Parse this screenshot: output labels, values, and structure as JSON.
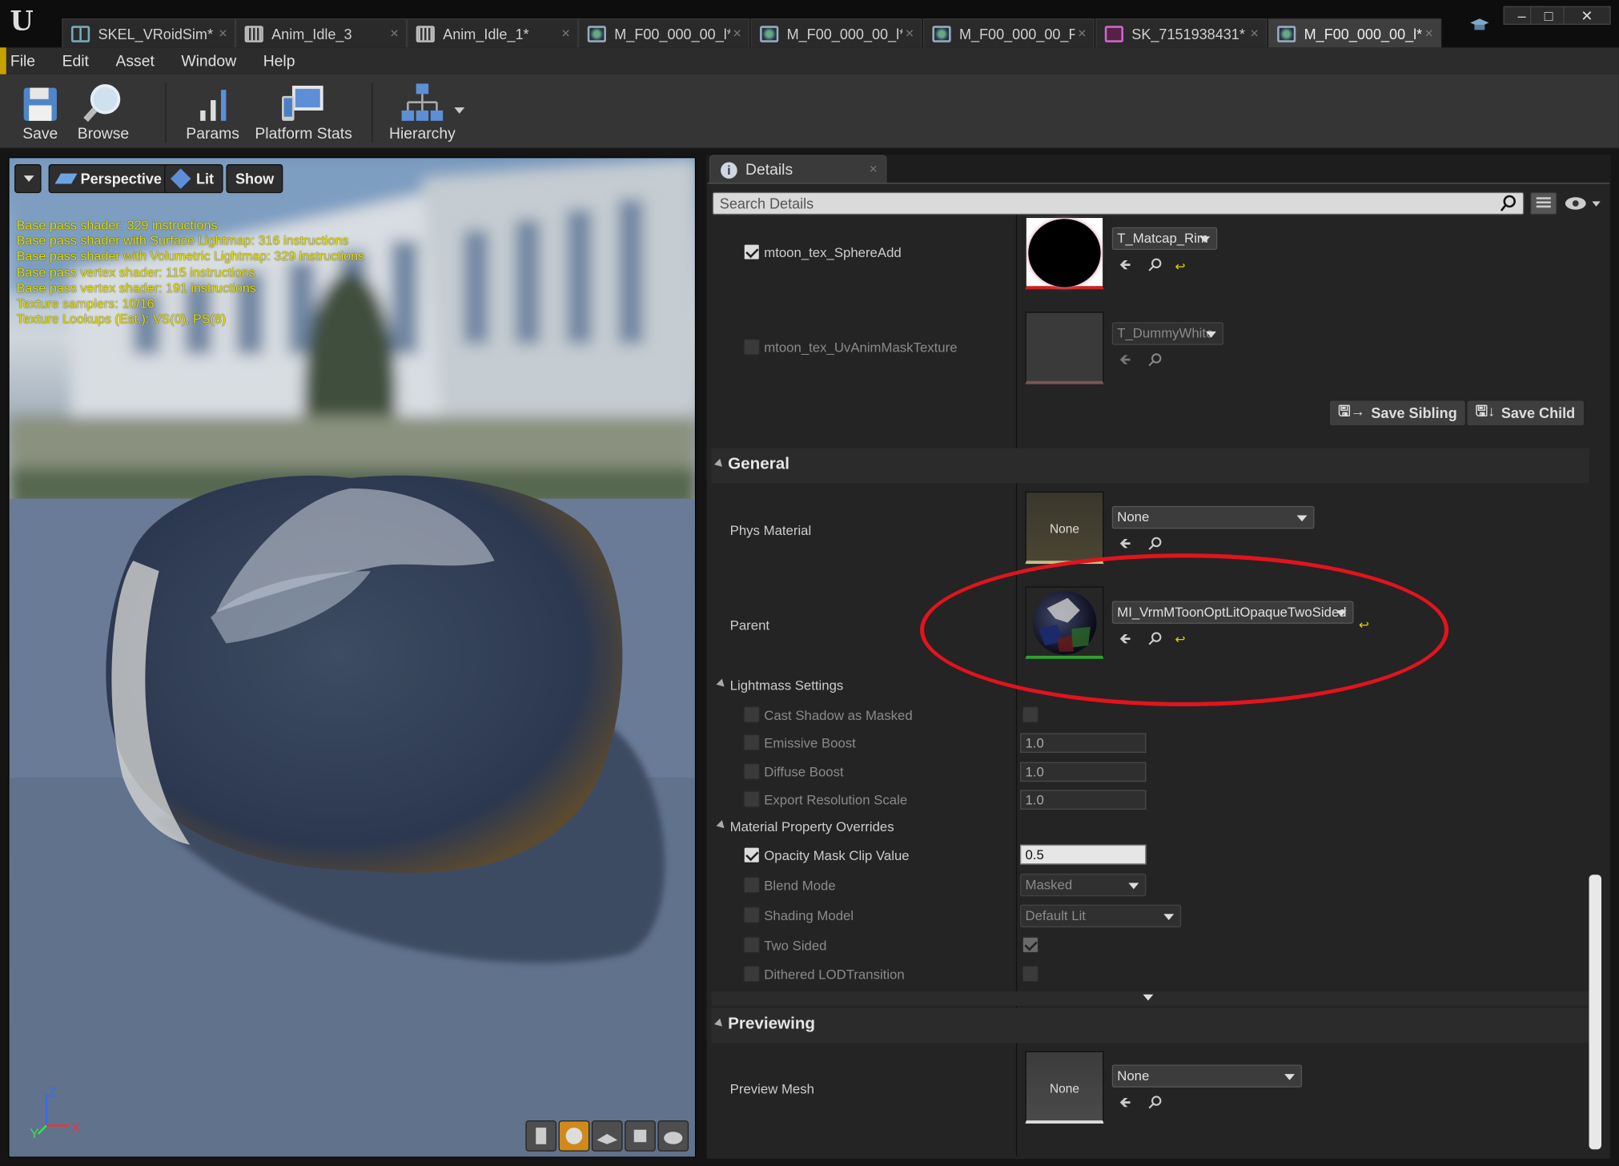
{
  "window": {
    "tabs": [
      {
        "label": "SKEL_VRoidSim*",
        "icon": "skeleton-icon"
      },
      {
        "label": "Anim_Idle_3",
        "icon": "animation-icon"
      },
      {
        "label": "Anim_Idle_1*",
        "icon": "animation-icon"
      },
      {
        "label": "M_F00_000_00_l*",
        "icon": "material-instance-icon"
      },
      {
        "label": "M_F00_000_00_l*",
        "icon": "material-instance-icon"
      },
      {
        "label": "M_F00_000_00_F",
        "icon": "material-instance-icon"
      },
      {
        "label": "SK_7151938431*",
        "icon": "skeletal-mesh-icon"
      },
      {
        "label": "M_F00_000_00_l*",
        "icon": "material-instance-icon"
      }
    ],
    "controls": {
      "minimize": "–",
      "maximize": "□",
      "close": "✕"
    }
  },
  "menu": [
    "File",
    "Edit",
    "Asset",
    "Window",
    "Help"
  ],
  "toolbar": {
    "save": "Save",
    "browse": "Browse",
    "params": "Params",
    "platform_stats": "Platform Stats",
    "hierarchy": "Hierarchy"
  },
  "viewport": {
    "buttons": {
      "perspective": "Perspective",
      "lit": "Lit",
      "show": "Show"
    },
    "stats": [
      "Base pass shader: 329 instructions",
      "Base pass shader with Surface Lightmap: 316 instructions",
      "Base pass shader with Volumetric Lightmap: 329 instructions",
      "Base pass vertex shader: 115 instructions",
      "Base pass vertex shader: 191 instructions",
      "Texture samplers: 10/16",
      "Texture Lookups (Est.): VS(0), PS(8)"
    ],
    "axes": {
      "z": "Z",
      "x": "X",
      "y": "Y"
    }
  },
  "details": {
    "tab_label": "Details",
    "search_placeholder": "Search Details",
    "textures": {
      "sphere_add": {
        "label": "mtoon_tex_SphereAdd",
        "value": "T_Matcap_Rim"
      },
      "uv_anim_mask": {
        "label": "mtoon_tex_UvAnimMaskTexture",
        "value": "T_DummyWhite"
      }
    },
    "save_sibling": "Save Sibling",
    "save_child": "Save Child",
    "general": {
      "title": "General",
      "phys_material_label": "Phys Material",
      "phys_material_value": "None",
      "phys_thumb_text": "None",
      "parent_label": "Parent",
      "parent_value": "MI_VrmMToonOptLitOpaqueTwoSided"
    },
    "lightmass": {
      "title": "Lightmass Settings",
      "cast_shadow_as_masked": "Cast Shadow as Masked",
      "emissive_boost": {
        "label": "Emissive Boost",
        "value": "1.0"
      },
      "diffuse_boost": {
        "label": "Diffuse Boost",
        "value": "1.0"
      },
      "export_resolution_scale": {
        "label": "Export Resolution Scale",
        "value": "1.0"
      }
    },
    "overrides": {
      "title": "Material Property Overrides",
      "opacity_mask_clip": {
        "label": "Opacity Mask Clip Value",
        "value": "0.5"
      },
      "blend_mode": {
        "label": "Blend Mode",
        "value": "Masked"
      },
      "shading_model": {
        "label": "Shading Model",
        "value": "Default Lit"
      },
      "two_sided": {
        "label": "Two Sided"
      },
      "dithered_lod": {
        "label": "Dithered LODTransition"
      }
    },
    "previewing": {
      "title": "Previewing",
      "preview_mesh_label": "Preview Mesh",
      "preview_mesh_value": "None",
      "preview_thumb_text": "None"
    }
  },
  "colors": {
    "annotation_ellipse": "#e3131d",
    "stats_text": "#e6e000"
  }
}
